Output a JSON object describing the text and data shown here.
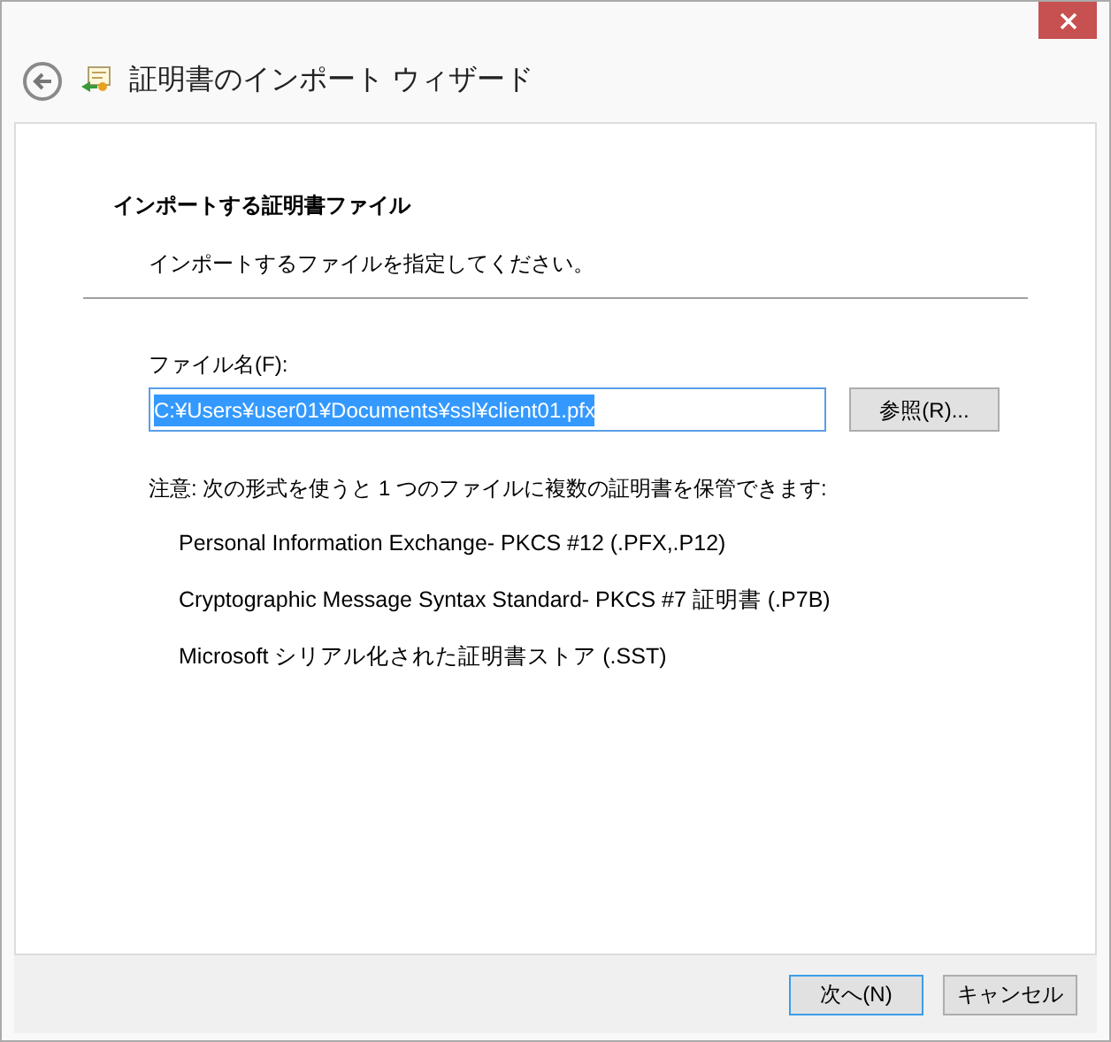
{
  "window": {
    "title": "証明書のインポート ウィザード"
  },
  "page": {
    "heading": "インポートする証明書ファイル",
    "subheading": "インポートするファイルを指定してください。"
  },
  "file_field": {
    "label": "ファイル名(F):",
    "value": "C:¥Users¥user01¥Documents¥ssl¥client01.pfx",
    "text_selected": true
  },
  "browse_button": "参照(R)...",
  "note": "注意: 次の形式を使うと 1 つのファイルに複数の証明書を保管できます:",
  "formats": [
    "Personal Information Exchange- PKCS #12 (.PFX,.P12)",
    "Cryptographic Message Syntax Standard- PKCS #7 証明書 (.P7B)",
    "Microsoft シリアル化された証明書ストア (.SST)"
  ],
  "buttons": [
    {
      "label": "次へ(N)",
      "default": true
    },
    {
      "label": "キャンセル",
      "default": false
    }
  ]
}
